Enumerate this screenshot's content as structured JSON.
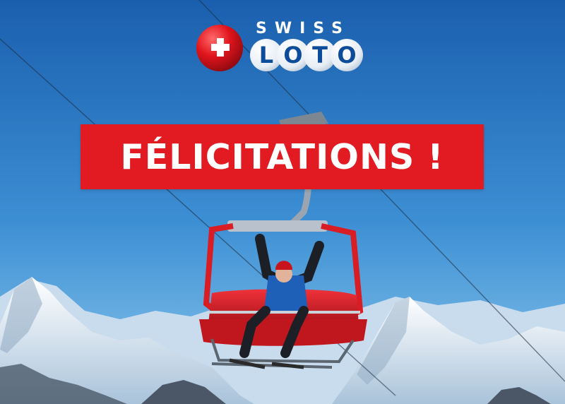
{
  "brand": {
    "top_word": "SWISS",
    "letters": [
      "L",
      "O",
      "T",
      "O"
    ],
    "cross_badge_icon": "swiss-cross-ball-icon"
  },
  "banner": {
    "headline": "FÉLICITATIONS !"
  },
  "colors": {
    "sky_top": "#1a5fae",
    "sky_bottom": "#7fc2ea",
    "banner_red": "#e21b22",
    "chair_red": "#d81d25",
    "logo_blue": "#0d4c9a"
  }
}
